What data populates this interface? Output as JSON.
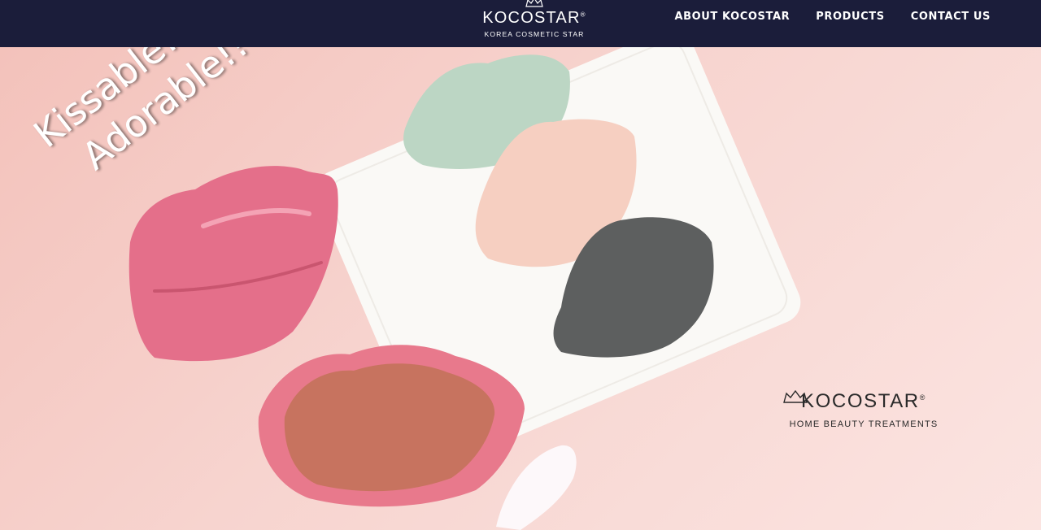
{
  "header": {
    "brand": {
      "name": "KOCOSTAR",
      "registered": "®",
      "tagline": "KOREA COSMETIC STAR"
    },
    "nav": [
      {
        "label": "ABOUT KOCOSTAR"
      },
      {
        "label": "PRODUCTS"
      },
      {
        "label": "CONTACT US"
      }
    ],
    "background": "#1b1d3a"
  },
  "hero": {
    "headline_line1": "Kissable!!",
    "headline_line2": "Adorable!!",
    "logo": {
      "name": "KOCOSTAR",
      "registered": "®",
      "tagline": "HOME BEAUTY TREATMENTS"
    },
    "colors": {
      "background": "#f6d6d2",
      "pink_lips": "#e46f8a",
      "mint_patch": "#bcd6c4",
      "peach_patch": "#f6cfc1",
      "gray_patch": "#5d5f5f",
      "tray": "#faf9f6",
      "jar_gel": "#c7735f"
    }
  }
}
